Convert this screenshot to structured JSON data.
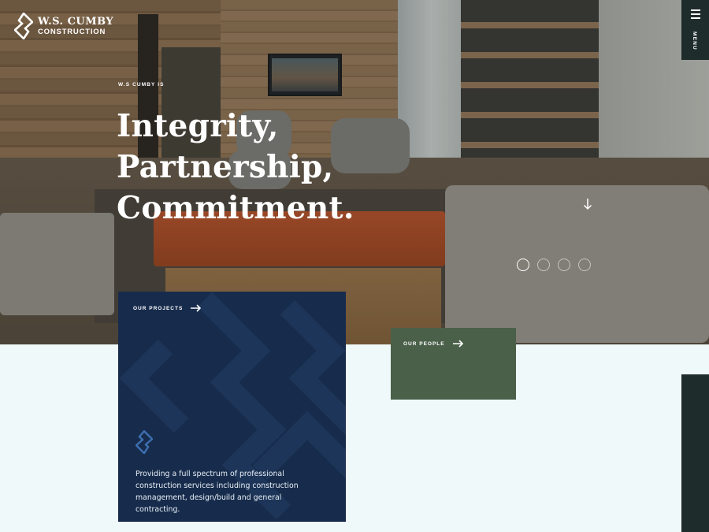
{
  "brand": {
    "name_line1": "W.S. CUMBY",
    "name_line2": "CONSTRUCTION",
    "logo_icon": "diamond-s-icon",
    "colors": {
      "navy": "#172c4c",
      "green": "#4a6049",
      "dark_rail": "#1f2c2c",
      "mint_background": "#eff9f9",
      "text_light": "#ffffff"
    }
  },
  "nav": {
    "menu_label": "MENU",
    "menu_icon": "hamburger-icon"
  },
  "hero": {
    "eyebrow": "W.S CUMBY IS",
    "headline": [
      "Integrity,",
      "Partnership,",
      "Commitment."
    ],
    "scroll_icon": "arrow-down-icon",
    "slides": {
      "count": 4,
      "active": 1
    },
    "background_image": "office-lounge-interior"
  },
  "cards": {
    "projects": {
      "link_label": "OUR PROJECTS",
      "link_icon": "arrow-right-icon",
      "mark_icon": "diamond-s-icon",
      "description": "Providing a full spectrum of professional construction services including construction management, design/build and general contracting."
    },
    "people": {
      "link_label": "OUR PEOPLE",
      "link_icon": "arrow-right-icon"
    }
  }
}
